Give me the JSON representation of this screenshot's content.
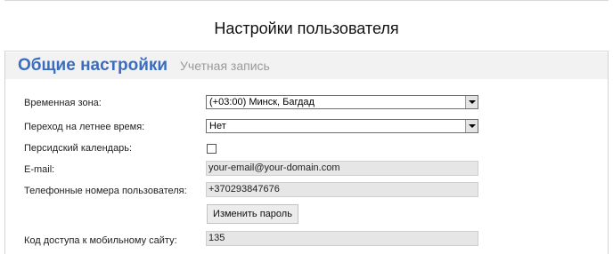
{
  "dialog": {
    "title": "Настройки пользователя"
  },
  "tabs": [
    {
      "label": "Общие настройки",
      "active": true
    },
    {
      "label": "Учетная запись",
      "active": false
    }
  ],
  "form": {
    "timezone": {
      "label": "Временная зона:",
      "value": "(+03:00) Минск, Багдад"
    },
    "dst": {
      "label": "Переход на летнее время:",
      "value": "Нет"
    },
    "persian_calendar": {
      "label": "Персидский календарь:",
      "checked": false
    },
    "email": {
      "label": "E-mail:",
      "value": "your-email@your-domain.com"
    },
    "phones": {
      "label": "Телефонные номера пользователя:",
      "value": "+370293847676"
    },
    "change_password_label": "Изменить пароль",
    "mobile_code": {
      "label": "Код доступа к мобильному сайту:",
      "value": "135"
    }
  },
  "colors": {
    "tab_active": "#3a6dbf",
    "tab_inactive": "#9a9a9a",
    "tabs_bg": "#f2f2f2",
    "readonly_field_bg": "#e6e6e6"
  }
}
